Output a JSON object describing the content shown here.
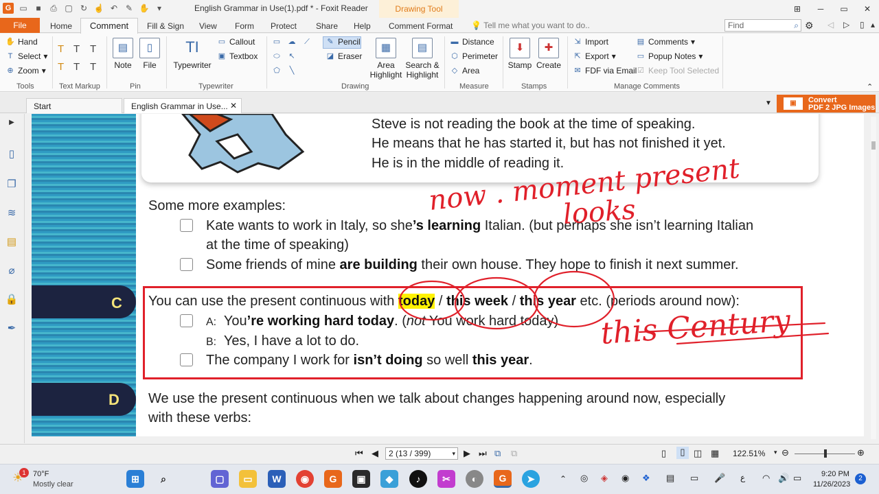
{
  "titlebar": {
    "document_title": "English Grammar in Use(1).pdf * - Foxit Reader",
    "context_tab": "Drawing Tool"
  },
  "ribbon_tabs": [
    "File",
    "Home",
    "Comment",
    "Fill & Sign",
    "View",
    "Form",
    "Protect",
    "Share",
    "Help",
    "Comment Format"
  ],
  "tell_me_placeholder": "Tell me what you want to do..",
  "find_placeholder": "Find",
  "ribbon": {
    "tools": {
      "hand": "Hand",
      "select": "Select",
      "zoom": "Zoom",
      "group": "Tools"
    },
    "text_markup_group": "Text Markup",
    "pin": {
      "note": "Note",
      "file": "File",
      "group": "Pin"
    },
    "typewriter": {
      "typewriter": "Typewriter",
      "callout": "Callout",
      "textbox": "Textbox",
      "group": "Typewriter"
    },
    "drawing": {
      "pencil": "Pencil",
      "eraser": "Eraser",
      "area_highlight_1": "Area",
      "area_highlight_2": "Highlight",
      "search_highlight_1": "Search &",
      "search_highlight_2": "Highlight",
      "group": "Drawing"
    },
    "measure": {
      "distance": "Distance",
      "perimeter": "Perimeter",
      "area": "Area",
      "group": "Measure"
    },
    "stamps": {
      "stamp": "Stamp",
      "create": "Create",
      "group": "Stamps"
    },
    "manage": {
      "import": "Import",
      "export": "Export",
      "fdf": "FDF via Email",
      "comments": "Comments",
      "popup": "Popup Notes",
      "keep": "Keep Tool Selected",
      "group": "Manage Comments"
    }
  },
  "doc_tabs": {
    "start": "Start",
    "current": "English Grammar in Use..."
  },
  "convert_banner": {
    "line1": "Convert",
    "line2": "PDF 2 JPG Images"
  },
  "page_content": {
    "intro_lines": [
      "Steve is not reading the book at the time of speaking.",
      "He means that he has started it, but has not finished it yet.",
      "He is in the middle of reading it."
    ],
    "examples_heading": "Some more examples:",
    "ex1_pre": "Kate wants to work in Italy, so she",
    "ex1_bold": "’s learning",
    "ex1_post": " Italian.   (but perhaps she isn’t learning Italian",
    "ex1_line2": "at the time of speaking)",
    "ex2_pre": "Some friends of mine ",
    "ex2_bold": "are building",
    "ex2_post": " their own house.  They hope to finish it next summer.",
    "section_c": "C",
    "c_pre": "You can use the present continuous with ",
    "c_today": "today",
    "c_sep1": " / ",
    "c_week": "this week",
    "c_sep2": " / ",
    "c_year": "this year",
    "c_post": " etc. (periods around now):",
    "a_label": "A:",
    "a_pre": "You",
    "a_bold": "’re working hard today",
    "a_post": ".   (",
    "a_not": "not",
    "a_rest": " You work hard today)",
    "b_label": "B:",
    "b_text": "Yes, I have a lot to do.",
    "co_pre": "The company I work for ",
    "co_bold1": "isn’t doing",
    "co_mid": " so well ",
    "co_bold2": "this year",
    "co_end": ".",
    "section_d": "D",
    "d_line1": "We use the present continuous when we talk about changes happening around now, especially",
    "d_line2": "with these verbs:"
  },
  "handwriting": {
    "line1": "now . moment present",
    "line2": "looks",
    "line3": "this Century"
  },
  "status": {
    "page": "2 (13 / 399)",
    "zoom": "122.51%"
  },
  "taskbar": {
    "temp": "70°F",
    "weather": "Mostly clear",
    "weather_badge": "1",
    "time": "9:20 PM",
    "date": "11/26/2023",
    "notif": "2"
  },
  "colors": {
    "accent": "#e8671b",
    "ink": "#e0202a",
    "highlight": "#fff200",
    "section_letter": "#f4e37a"
  }
}
